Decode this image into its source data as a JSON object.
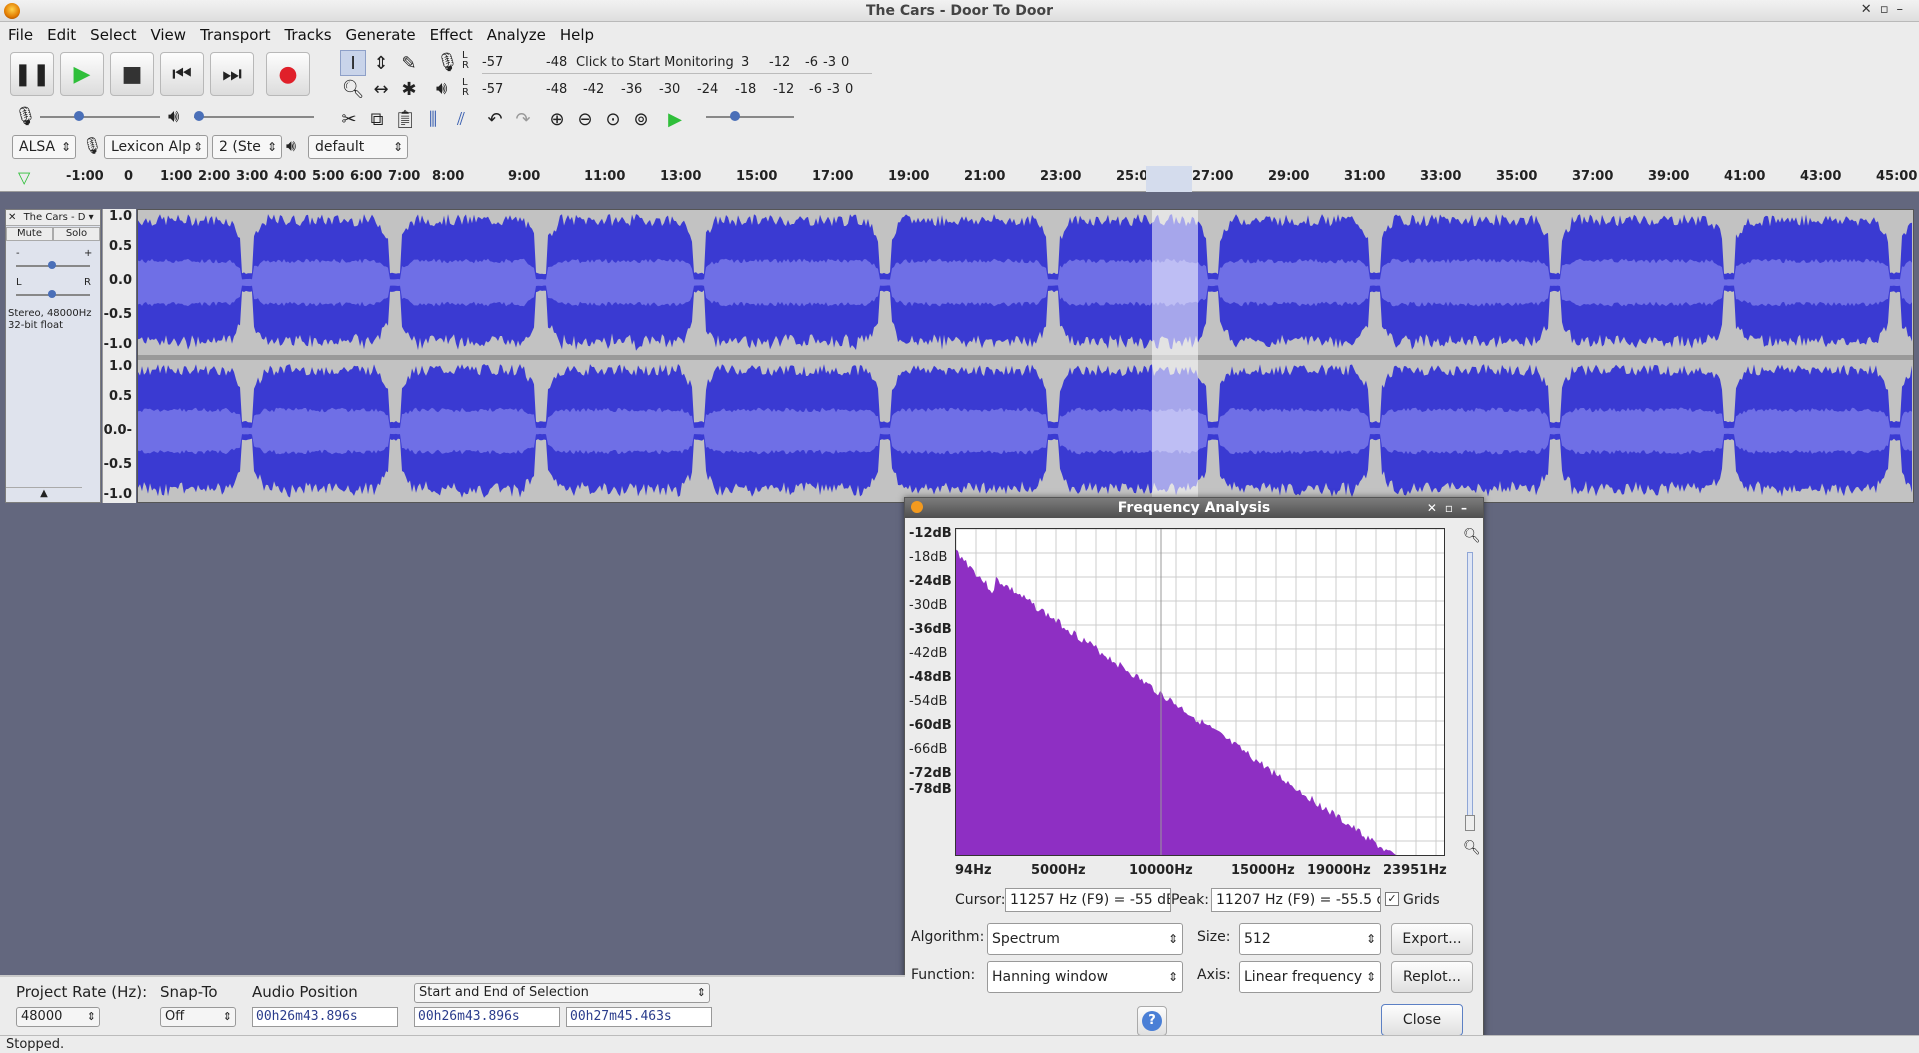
{
  "window": {
    "title": "The Cars - Door To Door"
  },
  "menu": [
    "File",
    "Edit",
    "Select",
    "View",
    "Transport",
    "Tracks",
    "Generate",
    "Effect",
    "Analyze",
    "Help"
  ],
  "meters": {
    "record_scale": [
      "-57",
      "-48",
      "Click to Start Monitoring",
      "3",
      "-12",
      "-6",
      "-3",
      "0"
    ],
    "play_scale": [
      "-57",
      "-48",
      "-42",
      "-36",
      "-30",
      "-24",
      "-18",
      "-12",
      "-6",
      "-3",
      "0"
    ],
    "channels": [
      "L",
      "R"
    ]
  },
  "devices": {
    "host": "ALSA",
    "recording_device": "Lexicon Alp",
    "channels": "2 (Ste",
    "playback_device": "default"
  },
  "ruler": {
    "ticks": [
      "-1:00",
      "0",
      "1:00",
      "2:00",
      "3:00",
      "4:00",
      "5:00",
      "6:00",
      "7:00",
      "8:00",
      "9:00",
      "11:00",
      "13:00",
      "15:00",
      "17:00",
      "19:00",
      "21:00",
      "23:00",
      "25:00",
      "27:00",
      "29:00",
      "31:00",
      "33:00",
      "35:00",
      "37:00",
      "39:00",
      "41:00",
      "43:00",
      "45:00"
    ]
  },
  "track": {
    "name": "The Cars - D",
    "mute": "Mute",
    "solo": "Solo",
    "gain_minus": "-",
    "gain_plus": "+",
    "pan_l": "L",
    "pan_r": "R",
    "info1": "Stereo, 48000Hz",
    "info2": "32-bit float"
  },
  "vscale": {
    "top": [
      "1.0",
      "0.5",
      "0.0",
      "-0.5",
      "-1.0"
    ],
    "bottom": [
      "1.0",
      "0.5",
      "0.0-",
      "-0.5",
      "-1.0"
    ]
  },
  "freq_dialog": {
    "title": "Frequency Analysis",
    "db_labels": [
      "-12dB",
      "-18dB",
      "-24dB",
      "-30dB",
      "-36dB",
      "-42dB",
      "-48dB",
      "-54dB",
      "-60dB",
      "-66dB",
      "-72dB",
      "-78dB"
    ],
    "hz_labels": [
      "94Hz",
      "5000Hz",
      "10000Hz",
      "15000Hz",
      "19000Hz",
      "23951Hz"
    ],
    "cursor_label": "Cursor:",
    "cursor_value": "11257 Hz (F9) = -55 dB",
    "peak_label": "Peak:",
    "peak_value": "11207 Hz (F9) = -55.5 d",
    "grids_label": "Grids",
    "grids_checked": true,
    "algorithm_label": "Algorithm:",
    "algorithm_value": "Spectrum",
    "size_label": "Size:",
    "size_value": "512",
    "export_label": "Export...",
    "function_label": "Function:",
    "function_value": "Hanning window",
    "axis_label": "Axis:",
    "axis_value": "Linear frequency",
    "replot_label": "Replot...",
    "help_label": "?",
    "close_label": "Close",
    "spectrum_color": "#8e2fc3"
  },
  "bottom": {
    "project_rate_label": "Project Rate (Hz):",
    "project_rate_value": "48000",
    "snap_label": "Snap-To",
    "snap_value": "Off",
    "audio_pos_label": "Audio Position",
    "audio_pos_value": "00h26m43.896s",
    "selection_mode": "Start and End of Selection",
    "sel_start": "00h26m43.896s",
    "sel_end": "00h27m45.463s"
  },
  "status": "Stopped.",
  "colors": {
    "wave_dark": "#3a3ad2",
    "wave_light": "#6f6fe6",
    "record": "#e0202a",
    "play": "#2fbf3a"
  }
}
